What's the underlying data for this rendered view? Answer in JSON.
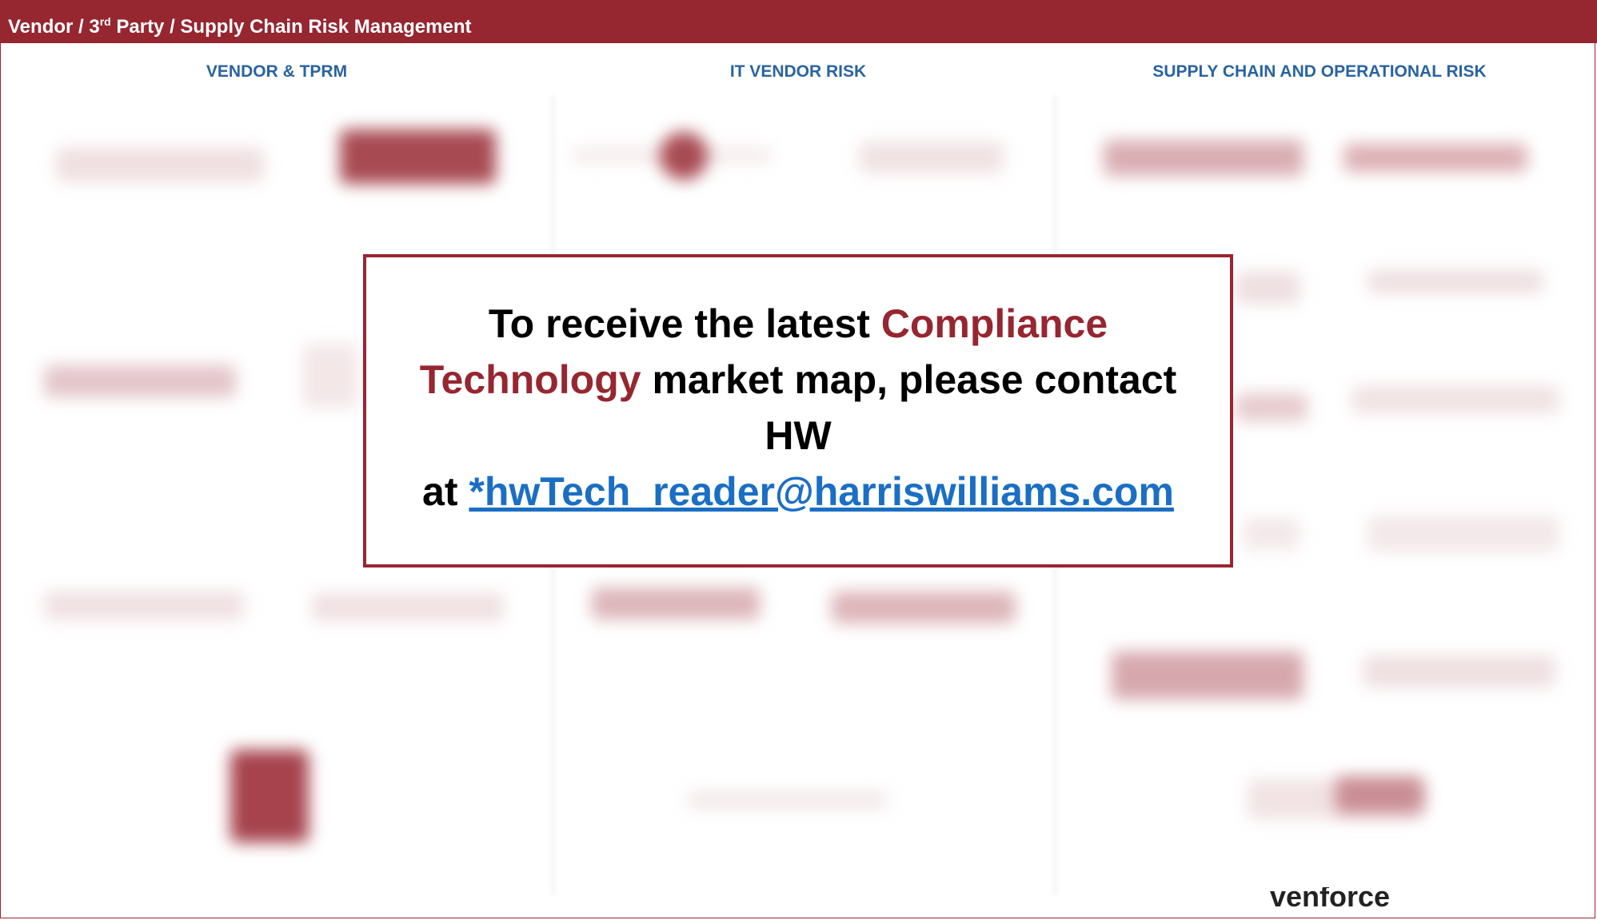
{
  "header": {
    "title_prefix": "Vendor / 3",
    "title_sup": "rd",
    "title_suffix": " Party / Supply Chain Risk Management"
  },
  "columns": [
    {
      "title": "VENDOR & TPRM"
    },
    {
      "title": "IT VENDOR RISK"
    },
    {
      "title": "SUPPLY CHAIN AND OPERATIONAL RISK"
    }
  ],
  "overlay": {
    "line1_start": "To receive the latest ",
    "line1_accent": "Compliance",
    "line2_accent": "Technology",
    "line2_rest": " market map, please contact",
    "line3": "HW",
    "line4_prefix": "at ",
    "email": "*hwTech_reader@harriswilliams.com"
  },
  "partial_logo_text": "venforce",
  "colors": {
    "header_bg": "#962630",
    "accent": "#962630",
    "column_title": "#2a63a0",
    "link": "#1a6fc4"
  }
}
